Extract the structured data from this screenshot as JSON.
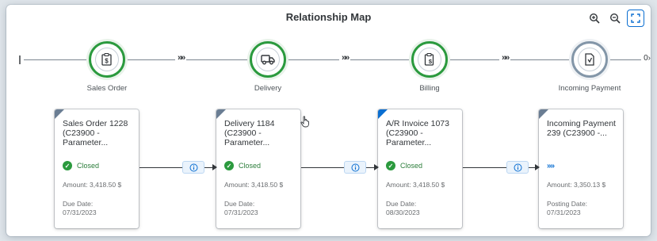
{
  "map": {
    "title": "Relationship Map",
    "next_label": "0"
  },
  "toolbar": {
    "zoom_in_icon": "zoom-in-icon",
    "zoom_out_icon": "zoom-out-icon",
    "fit_icon": "fit-screen-icon"
  },
  "flow": {
    "chevron": "»»"
  },
  "steps": [
    {
      "label": "Sales Order",
      "icon": "clipboard-currency-icon",
      "status_color": "#2b9a3e"
    },
    {
      "label": "Delivery",
      "icon": "truck-icon",
      "status_color": "#2b9a3e"
    },
    {
      "label": "Billing",
      "icon": "invoice-icon",
      "status_color": "#2b9a3e"
    },
    {
      "label": "Incoming Payment",
      "icon": "payment-document-icon",
      "status_color": "#8396a8"
    }
  ],
  "cards": [
    {
      "title": "Sales Order 1228 (C23900 - Parameter...",
      "status": "Closed",
      "amount": "Amount: 3,418.50 $",
      "date_label": "Due Date:",
      "date_value": "07/31/2023"
    },
    {
      "title": "Delivery 1184 (C23900 - Parameter...",
      "status": "Closed",
      "amount": "Amount: 3,418.50 $",
      "date_label": "Due Date:",
      "date_value": "07/31/2023"
    },
    {
      "title": "A/R Invoice 1073 (C23900 - Parameter...",
      "status": "Closed",
      "amount": "Amount: 3,418.50 $",
      "date_label": "Due Date:",
      "date_value": "08/30/2023"
    },
    {
      "title": "Incoming Payment 239 (C23900 -...",
      "status": "»»",
      "amount": "Amount: 3,350.13 $",
      "date_label": "Posting Date:",
      "date_value": "07/31/2023"
    }
  ],
  "colors": {
    "success": "#2b9a3e",
    "accent": "#0a6ed1",
    "pending": "#8396a8"
  }
}
